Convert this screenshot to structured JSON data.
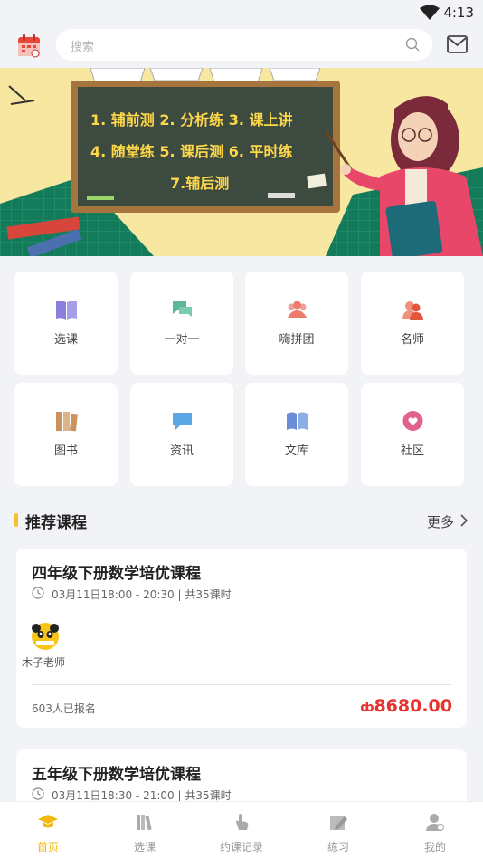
{
  "status": {
    "time": "4:13"
  },
  "search": {
    "placeholder": "搜索"
  },
  "banner": {
    "board_lines": [
      "1. 辅前测 2. 分析练 3. 课上讲",
      "4. 随堂练 5. 课后测 6. 平时练",
      "7.辅后测"
    ]
  },
  "menu": [
    {
      "label": "选课",
      "icon": "book-open-icon",
      "color": "#8a7fdc"
    },
    {
      "label": "一对一",
      "icon": "chat-bubbles-icon",
      "color": "#5bb89a"
    },
    {
      "label": "嗨拼团",
      "icon": "group-people-icon",
      "color": "#ee7a6a"
    },
    {
      "label": "名师",
      "icon": "teacher-icon",
      "color": "#ee6a52"
    },
    {
      "label": "图书",
      "icon": "books-icon",
      "color": "#c9925e"
    },
    {
      "label": "资讯",
      "icon": "message-icon",
      "color": "#5ba7e6"
    },
    {
      "label": "文库",
      "icon": "library-icon",
      "color": "#6a8fd6"
    },
    {
      "label": "社区",
      "icon": "heart-bubble-icon",
      "color": "#e0638a"
    }
  ],
  "section": {
    "title": "推荐课程",
    "more": "更多"
  },
  "courses": [
    {
      "title": "四年级下册数学培优课程",
      "time": "03月11日18:00 - 20:30 | 共35课时",
      "teacher": "木子老师",
      "signed": "603人已报名",
      "currency": "ȸ",
      "price": "8680.00"
    },
    {
      "title": "五年级下册数学培优课程",
      "time": "03月11日18:30 - 21:00 | 共35课时"
    }
  ],
  "tabs": [
    {
      "label": "首页",
      "icon": "graduation-cap-icon",
      "active": true
    },
    {
      "label": "选课",
      "icon": "books-shelf-icon",
      "active": false
    },
    {
      "label": "约课记录",
      "icon": "hand-pointer-icon",
      "active": false
    },
    {
      "label": "练习",
      "icon": "pencil-note-icon",
      "active": false
    },
    {
      "label": "我的",
      "icon": "user-icon",
      "active": false
    }
  ],
  "colors": {
    "accent": "#f5b80f",
    "price": "#e8322d",
    "background": "#f2f3f7"
  }
}
